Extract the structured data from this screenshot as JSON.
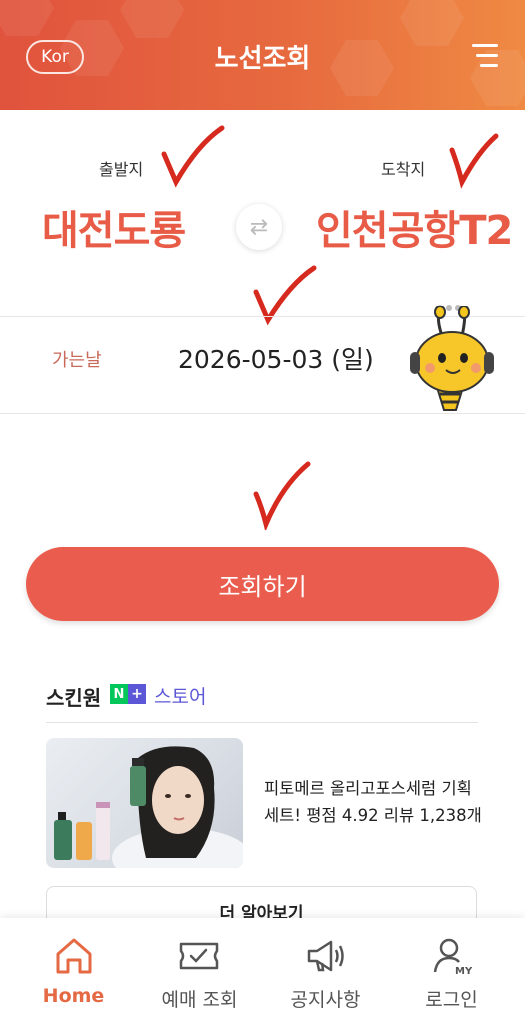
{
  "header": {
    "language": "Kor",
    "title": "노선조회"
  },
  "route": {
    "departure_label": "출발지",
    "departure_station": "대전도룡",
    "arrival_label": "도착지",
    "arrival_station": "인천공항T2"
  },
  "date": {
    "label": "가는날",
    "value": "2026-05-03 (일)"
  },
  "search_button": "조회하기",
  "ad": {
    "brand": "스킨원",
    "badge_n": "N",
    "badge_plus": "+",
    "store": "스토어",
    "description": "피토메르 올리고포스세럼 기획세트! 평점 4.92 리뷰 1,238개",
    "more_button": "더 알아보기"
  },
  "bottom_nav": {
    "home": "Home",
    "reservations": "예매 조회",
    "notices": "공지사항",
    "login": "로그인",
    "login_icon_text": "MY"
  },
  "colors": {
    "accent": "#ea5d4e",
    "header_start": "#e0533d",
    "header_end": "#ef8a43",
    "store_purple": "#5c57d6",
    "naver_green": "#03c75a"
  }
}
